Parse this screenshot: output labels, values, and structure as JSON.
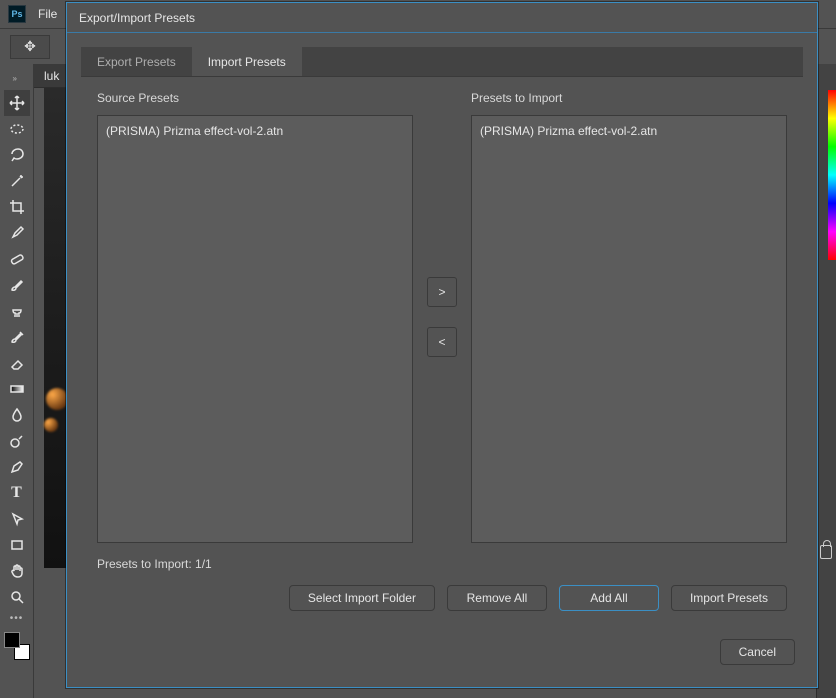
{
  "app": {
    "logo_text": "Ps",
    "menubar": {
      "file": "File"
    },
    "doc_tab": "luk"
  },
  "tools": [
    {
      "name": "move-tool",
      "svg": "move",
      "selected": true
    },
    {
      "name": "marquee-tool",
      "svg": "marquee"
    },
    {
      "name": "lasso-tool",
      "svg": "lasso"
    },
    {
      "name": "magic-wand-tool",
      "svg": "wand"
    },
    {
      "name": "crop-tool",
      "svg": "crop"
    },
    {
      "name": "eyedropper-tool",
      "svg": "eyedrop"
    },
    {
      "name": "healing-brush-tool",
      "svg": "bandaid"
    },
    {
      "name": "brush-tool",
      "svg": "brush"
    },
    {
      "name": "stamp-tool",
      "svg": "stamp"
    },
    {
      "name": "history-brush-tool",
      "svg": "histbrush"
    },
    {
      "name": "eraser-tool",
      "svg": "eraser"
    },
    {
      "name": "gradient-tool",
      "svg": "gradient"
    },
    {
      "name": "blur-tool",
      "svg": "drop"
    },
    {
      "name": "dodge-tool",
      "svg": "dodge"
    },
    {
      "name": "pen-tool",
      "svg": "pen"
    },
    {
      "name": "type-tool",
      "svg": "type"
    },
    {
      "name": "path-selection-tool",
      "svg": "cursor"
    },
    {
      "name": "shape-tool",
      "svg": "rect"
    },
    {
      "name": "hand-tool",
      "svg": "hand"
    },
    {
      "name": "zoom-tool",
      "svg": "zoom"
    }
  ],
  "dialog": {
    "title": "Export/Import Presets",
    "tabs": {
      "export": "Export Presets",
      "import": "Import Presets"
    },
    "source_heading": "Source Presets",
    "target_heading": "Presets to Import",
    "source_items": [
      "(PRISMA)  Prizma effect-vol-2.atn"
    ],
    "target_items": [
      "(PRISMA)  Prizma effect-vol-2.atn"
    ],
    "move_right": ">",
    "move_left": "<",
    "status": "Presets to Import: 1/1",
    "buttons": {
      "select_folder": "Select Import Folder",
      "remove_all": "Remove All",
      "add_all": "Add All",
      "import": "Import Presets"
    },
    "cancel": "Cancel"
  }
}
